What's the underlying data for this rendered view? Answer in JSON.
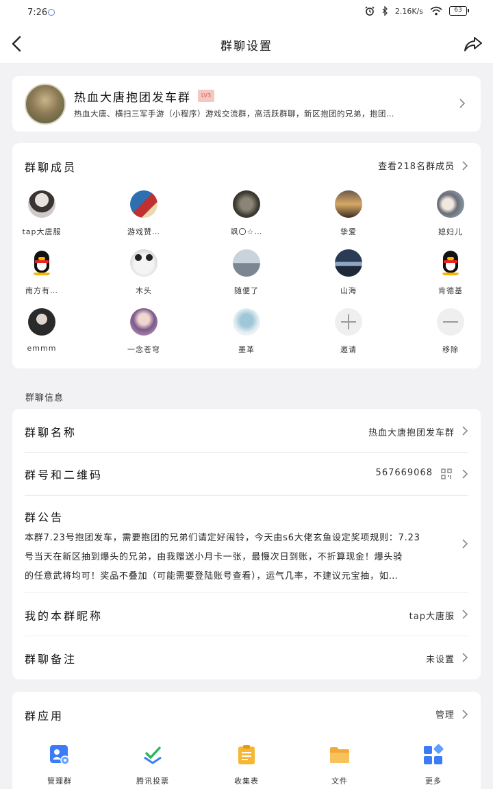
{
  "status_bar": {
    "time": "7:26",
    "net_speed": "2.16K/s",
    "battery": "63"
  },
  "nav": {
    "title": "群聊设置"
  },
  "group": {
    "name": "热血大唐抱团发车群",
    "level": "LV3",
    "desc": "热血大唐、横扫三军手游（小程序）游戏交流群，高活跃群聊，新区抱团的兄弟，抱团…"
  },
  "members": {
    "title": "群聊成员",
    "view_all": "查看218名群成员",
    "list": [
      {
        "name": "tap大唐服",
        "avatar": "person-photo"
      },
      {
        "name": "游戏赞…",
        "avatar": "photo"
      },
      {
        "name": "飒〇☆…",
        "avatar": "photo"
      },
      {
        "name": "挚爱",
        "avatar": "sunset-photo"
      },
      {
        "name": "媳妇儿",
        "avatar": "photo"
      },
      {
        "name": "南方有…",
        "avatar": "qq-penguin"
      },
      {
        "name": "木头",
        "avatar": "panda"
      },
      {
        "name": "随便了",
        "avatar": "city-photo"
      },
      {
        "name": "山海",
        "avatar": "sea-photo"
      },
      {
        "name": "肯德基",
        "avatar": "qq-penguin"
      },
      {
        "name": "emmm",
        "avatar": "person-photo"
      },
      {
        "name": "一念苍穹",
        "avatar": "anime"
      },
      {
        "name": "墨革",
        "avatar": "anime"
      }
    ],
    "invite_label": "邀请",
    "remove_label": "移除"
  },
  "info": {
    "section_label": "群聊信息",
    "group_name_label": "群聊名称",
    "group_name_value": "热血大唐抱团发车群",
    "group_number_label": "群号和二维码",
    "group_number_value": "567669068",
    "notice_label": "群公告",
    "notice_lines": [
      "本群7.23号抱团发车，需要抱团的兄弟们请定好闹铃，今天由s6大佬玄鱼设定奖项规则：7.23",
      "号当天在新区抽到爆头的兄弟，由我赠送小月卡一张，最慢次日到账，不折算现金！爆头骑",
      "的任意武将均可！奖品不叠加（可能需要登陆账号查看），运气几率，不建议元宝抽，如…"
    ],
    "nickname_label": "我的本群昵称",
    "nickname_value": "tap大唐服",
    "remark_label": "群聊备注",
    "remark_value": "未设置"
  },
  "apps": {
    "title": "群应用",
    "manage": "管理",
    "items": [
      {
        "name": "管理群",
        "icon": "group-manage-icon"
      },
      {
        "name": "腾讯投票",
        "icon": "vote-icon"
      },
      {
        "name": "收集表",
        "icon": "form-icon"
      },
      {
        "name": "文件",
        "icon": "folder-icon"
      },
      {
        "name": "更多",
        "icon": "more-apps-icon"
      }
    ]
  },
  "colors": {
    "accent_blue": "#3b7cf6",
    "background": "#f2f2f4",
    "badge": "#f3c7c2"
  }
}
